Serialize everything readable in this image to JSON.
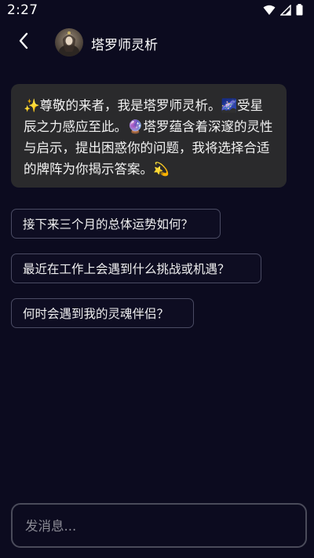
{
  "status_bar": {
    "time": "2:27"
  },
  "header": {
    "back_icon": "chevron-left-icon",
    "title": "塔罗师灵析"
  },
  "message": {
    "sender": "assistant",
    "text": "✨尊敬的来者，我是塔罗师灵析。🌌受星辰之力感应至此。🔮塔罗蕴含着深邃的灵性与启示，提出困惑你的问题，我将选择合适的牌阵为你揭示答案。💫"
  },
  "suggestions": [
    {
      "label": "接下来三个月的总体运势如何？"
    },
    {
      "label": "最近在工作上会遇到什么挑战或机遇？"
    },
    {
      "label": "何时会遇到我的灵魂伴侣？"
    }
  ],
  "composer": {
    "placeholder": "发消息...",
    "value": ""
  },
  "colors": {
    "background": "#0c0b1f",
    "bubble": "#2a2a2c",
    "chip_border": "#4a4b63"
  }
}
